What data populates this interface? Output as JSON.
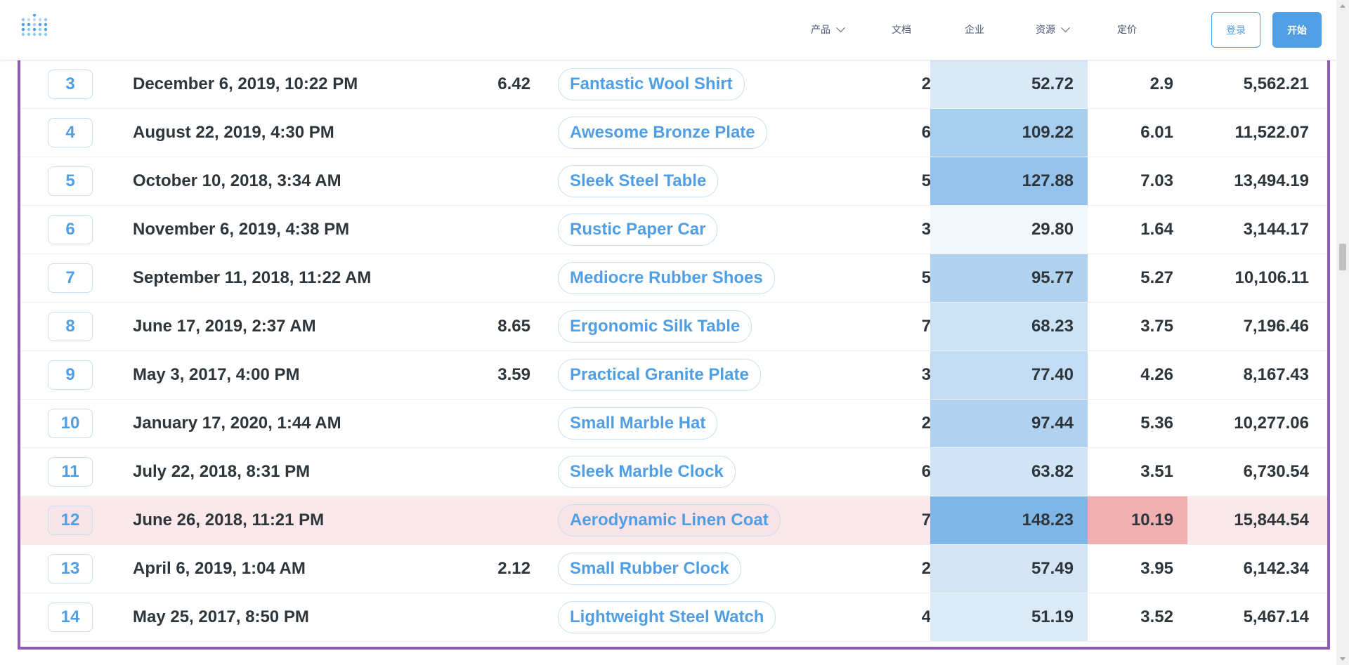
{
  "nav": {
    "items": [
      {
        "label": "产品",
        "dropdown": true
      },
      {
        "label": "文档",
        "dropdown": false
      },
      {
        "label": "企业",
        "dropdown": false
      },
      {
        "label": "资源",
        "dropdown": true
      },
      {
        "label": "定价",
        "dropdown": false
      }
    ],
    "login_label": "登录",
    "start_label": "开始"
  },
  "colors": {
    "accent": "#509ee3",
    "frame": "#8e5bb7",
    "highlight_row": "#fbe8ea",
    "highlight_cell": "#f0b0b0"
  },
  "table": {
    "partial_row": {
      "subtotal_fill": "#a7cdef"
    },
    "rows": [
      {
        "id": "3",
        "date": "December 6, 2019, 10:22 PM",
        "tax": "6.42",
        "product": "Fantastic Wool Shirt",
        "quantity": "2",
        "subtotal": "52.72",
        "discount": "2.9",
        "total": "5,562.21",
        "subtotal_fill": "#dae9f7",
        "discount_fill": "",
        "highlight": false
      },
      {
        "id": "4",
        "date": "August 22, 2019, 4:30 PM",
        "tax": "",
        "product": "Awesome Bronze Plate",
        "quantity": "6",
        "subtotal": "109.22",
        "discount": "6.01",
        "total": "11,522.07",
        "subtotal_fill": "#a7cdef",
        "discount_fill": "",
        "highlight": false
      },
      {
        "id": "5",
        "date": "October 10, 2018, 3:34 AM",
        "tax": "",
        "product": "Sleek Steel Table",
        "quantity": "5",
        "subtotal": "127.88",
        "discount": "7.03",
        "total": "13,494.19",
        "subtotal_fill": "#93c2ec",
        "discount_fill": "",
        "highlight": false
      },
      {
        "id": "6",
        "date": "November 6, 2019, 4:38 PM",
        "tax": "",
        "product": "Rustic Paper Car",
        "quantity": "3",
        "subtotal": "29.80",
        "discount": "1.64",
        "total": "3,144.17",
        "subtotal_fill": "#f1f7fc",
        "discount_fill": "",
        "highlight": false
      },
      {
        "id": "7",
        "date": "September 11, 2018, 11:22 AM",
        "tax": "",
        "product": "Mediocre Rubber Shoes",
        "quantity": "5",
        "subtotal": "95.77",
        "discount": "5.27",
        "total": "10,106.11",
        "subtotal_fill": "#b2d3f0",
        "discount_fill": "",
        "highlight": false
      },
      {
        "id": "8",
        "date": "June 17, 2019, 2:37 AM",
        "tax": "8.65",
        "product": "Ergonomic Silk Table",
        "quantity": "7",
        "subtotal": "68.23",
        "discount": "3.75",
        "total": "7,196.46",
        "subtotal_fill": "#cce2f5",
        "discount_fill": "",
        "highlight": false
      },
      {
        "id": "9",
        "date": "May 3, 2017, 4:00 PM",
        "tax": "3.59",
        "product": "Practical Granite Plate",
        "quantity": "3",
        "subtotal": "77.40",
        "discount": "4.26",
        "total": "8,167.43",
        "subtotal_fill": "#c2dcf3",
        "discount_fill": "",
        "highlight": false
      },
      {
        "id": "10",
        "date": "January 17, 2020, 1:44 AM",
        "tax": "",
        "product": "Small Marble Hat",
        "quantity": "2",
        "subtotal": "97.44",
        "discount": "5.36",
        "total": "10,277.06",
        "subtotal_fill": "#b0d2f0",
        "discount_fill": "",
        "highlight": false
      },
      {
        "id": "11",
        "date": "July 22, 2018, 8:31 PM",
        "tax": "",
        "product": "Sleek Marble Clock",
        "quantity": "6",
        "subtotal": "63.82",
        "discount": "3.51",
        "total": "6,730.54",
        "subtotal_fill": "#cfe4f6",
        "discount_fill": "",
        "highlight": false
      },
      {
        "id": "12",
        "date": "June 26, 2018, 11:21 PM",
        "tax": "",
        "product": "Aerodynamic Linen Coat",
        "quantity": "7",
        "subtotal": "148.23",
        "discount": "10.19",
        "total": "15,844.54",
        "subtotal_fill": "#7fb6e8",
        "discount_fill": "#f0b0b0",
        "highlight": true
      },
      {
        "id": "13",
        "date": "April 6, 2019, 1:04 AM",
        "tax": "2.12",
        "product": "Small Rubber Clock",
        "quantity": "2",
        "subtotal": "57.49",
        "discount": "3.95",
        "total": "6,142.34",
        "subtotal_fill": "#d4e6f6",
        "discount_fill": "",
        "highlight": false
      },
      {
        "id": "14",
        "date": "May 25, 2017, 8:50 PM",
        "tax": "",
        "product": "Lightweight Steel Watch",
        "quantity": "4",
        "subtotal": "51.19",
        "discount": "3.52",
        "total": "5,467.14",
        "subtotal_fill": "#dbeaf7",
        "discount_fill": "",
        "highlight": false
      }
    ]
  }
}
